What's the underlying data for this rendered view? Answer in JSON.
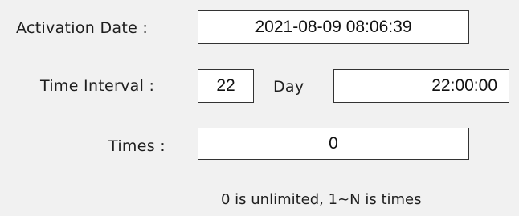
{
  "form": {
    "activation_date": {
      "label": "Activation Date :",
      "value": "2021-08-09 08:06:39"
    },
    "time_interval": {
      "label": "Time Interval :",
      "days_value": "22",
      "unit_label": "Day",
      "time_value": "22:00:00"
    },
    "times": {
      "label": "Times :",
      "value": "0"
    },
    "hint": "0 is unlimited, 1~N is times"
  }
}
